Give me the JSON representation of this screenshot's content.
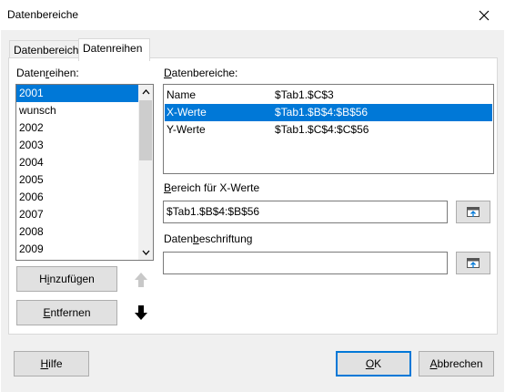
{
  "window": {
    "title": "Datenbereiche",
    "close_label": "✕"
  },
  "tabs": [
    {
      "label": "Datenbereich",
      "active": false
    },
    {
      "label": "Datenreihen",
      "active": true
    }
  ],
  "series_panel": {
    "label_prefix": "Daten",
    "label_mnemonic": "r",
    "label_suffix": "eihen:",
    "items": [
      "2001",
      "wunsch",
      "2002",
      "2003",
      "2004",
      "2005",
      "2006",
      "2007",
      "2008",
      "2009"
    ],
    "selected_index": 0,
    "add_prefix": "H",
    "add_mnemonic": "i",
    "add_suffix": "nzufügen",
    "remove_prefix": "",
    "remove_mnemonic": "E",
    "remove_suffix": "ntfernen",
    "move_up_icon": "arrow-up-icon",
    "move_down_icon": "arrow-down-icon"
  },
  "ranges_panel": {
    "label_mnemonic": "D",
    "label_suffix": "atenbereiche:",
    "rows": [
      {
        "name": "Name",
        "range": "$Tab1.$C$3",
        "selected": false
      },
      {
        "name": "X-Werte",
        "range": "$Tab1.$B$4:$B$56",
        "selected": true
      },
      {
        "name": "Y-Werte",
        "range": "$Tab1.$C$4:$C$56",
        "selected": false
      }
    ]
  },
  "x_range": {
    "label_mnemonic": "B",
    "label_suffix": "ereich für X-Werte",
    "value": "$Tab1.$B$4:$B$56"
  },
  "data_labels": {
    "label_prefix": "Daten",
    "label_mnemonic": "b",
    "label_suffix": "eschriftung",
    "value": ""
  },
  "footer": {
    "help_mnemonic": "H",
    "help_suffix": "ilfe",
    "ok_mnemonic": "O",
    "ok_suffix": "K",
    "cancel_mnemonic": "A",
    "cancel_suffix": "bbrechen"
  },
  "colors": {
    "selection": "#0078d7",
    "button_face": "#e1e1e1",
    "dialog_bg": "#f0f0f0"
  }
}
